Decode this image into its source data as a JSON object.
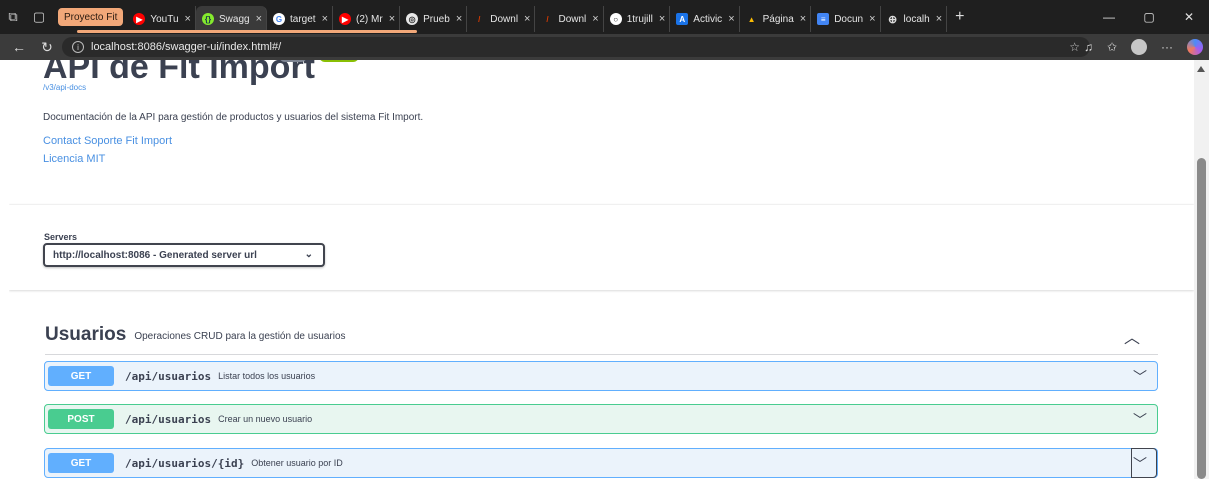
{
  "browser": {
    "group_label": "Proyecto Fit",
    "tabs": [
      {
        "title": "YouTu",
        "color": "#ff0000",
        "glyph": "▶"
      },
      {
        "title": "Swagg",
        "color": "#85ea2d",
        "glyph": "{}"
      },
      {
        "title": "target",
        "color": "#4285f4",
        "glyph": "G"
      },
      {
        "title": "(2) Mr",
        "color": "#ff0000",
        "glyph": "▶"
      },
      {
        "title": "Prueb",
        "color": "#555555",
        "glyph": "◎"
      },
      {
        "title": "Downl",
        "color": "#d83b01",
        "glyph": "/"
      },
      {
        "title": "Downl",
        "color": "#d83b01",
        "glyph": "/"
      },
      {
        "title": "1trujill",
        "color": "#8a8a8a",
        "glyph": "○"
      },
      {
        "title": "Activic",
        "color": "#1a73e8",
        "glyph": "A"
      },
      {
        "title": "Página",
        "color": "#fbbc04",
        "glyph": "▲"
      },
      {
        "title": "Docun",
        "color": "#4285f4",
        "glyph": "≡"
      },
      {
        "title": "localh",
        "color": "#8a8a8a",
        "glyph": "⊕"
      }
    ],
    "close_glyph": "×",
    "url": "localhost:8086/swagger-ui/index.html#/"
  },
  "api": {
    "title": "API de Fit Import",
    "spec_link": "/v3/api-docs",
    "description": "Documentación de la API para gestión de productos y usuarios del sistema Fit Import.",
    "contact": "Contact Soporte Fit Import",
    "license": "Licencia MIT"
  },
  "servers": {
    "label": "Servers",
    "selected": "http://localhost:8086 - Generated server url"
  },
  "tag": {
    "name": "Usuarios",
    "description": "Operaciones CRUD para la gestión de usuarios"
  },
  "operations": [
    {
      "method": "GET",
      "path": "/api/usuarios",
      "summary": "Listar todos los usuarios"
    },
    {
      "method": "POST",
      "path": "/api/usuarios",
      "summary": "Crear un nuevo usuario"
    },
    {
      "method": "GET",
      "path": "/api/usuarios/{id}",
      "summary": "Obtener usuario por ID"
    }
  ]
}
